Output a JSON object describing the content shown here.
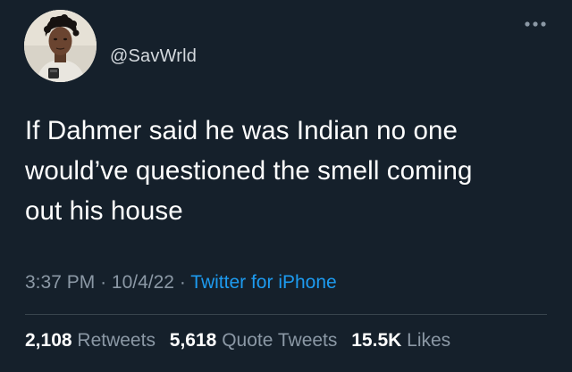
{
  "user": {
    "handle": "@SavWrld"
  },
  "tweet": {
    "text": "If Dahmer said he was Indian no one\nwould’ve questioned the smell coming\nout his house",
    "time": "3:37 PM",
    "date": "10/4/22",
    "separator": "·",
    "source": "Twitter for iPhone"
  },
  "stats": {
    "retweets_count": "2,108",
    "retweets_label": "Retweets",
    "quotes_count": "5,618",
    "quotes_label": "Quote Tweets",
    "likes_count": "15.5K",
    "likes_label": "Likes"
  },
  "colors": {
    "background": "#15202b",
    "text": "#ffffff",
    "secondary": "#8b98a5",
    "link": "#1d9bf0"
  },
  "icons": {
    "more": "more-dots-icon"
  }
}
